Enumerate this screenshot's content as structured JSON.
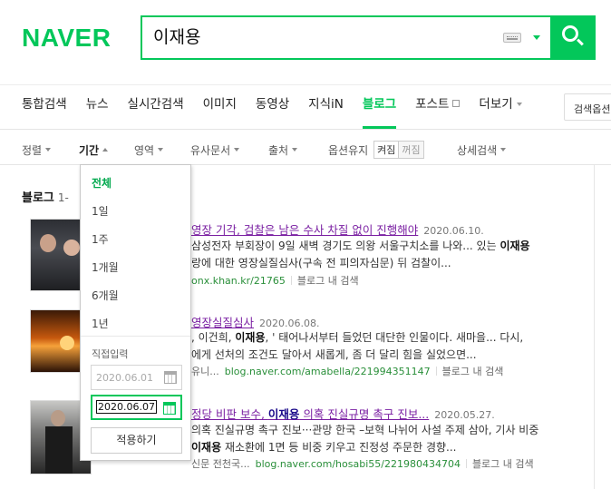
{
  "logo": "NAVER",
  "search": {
    "query": "이재용"
  },
  "tabs": [
    {
      "label": "통합검색"
    },
    {
      "label": "뉴스"
    },
    {
      "label": "실시간검색"
    },
    {
      "label": "이미지"
    },
    {
      "label": "동영상"
    },
    {
      "label": "지식iN"
    },
    {
      "label": "블로그"
    },
    {
      "label": "포스트"
    },
    {
      "label": "더보기"
    }
  ],
  "search_options_label": "검색옵션",
  "filters": {
    "sort": "정렬",
    "period": "기간",
    "area": "영역",
    "similar": "유사문서",
    "source": "출처",
    "option_keep": "옵션유지",
    "toggle_on": "켜짐",
    "toggle_off": "꺼짐",
    "detail": "상세검색"
  },
  "section": {
    "title": "블로그",
    "count": "1-"
  },
  "results": [
    {
      "title": "영장 기각, 검찰은 남은 수사 차질 없이 진행해야",
      "date": "2020.06.10.",
      "desc1_pre": "삼성전자 부회장이 9일 새벽 경기도 의왕 서울구치소를 나와... 있는 ",
      "desc1_bold": "이재용",
      "desc2": "랑에 대한 영장실질심사(구속 전 피의자심문) 뒤 검찰이...",
      "url": "onx.khan.kr/21765",
      "blog_link": "블로그 내 검색"
    },
    {
      "title": "영장실질심사",
      "date": "2020.06.08.",
      "desc1_pre": ", 이건희, ",
      "desc1_bold": "이재용",
      "desc1_post": ", ' 태어나서부터 들었던 대단한 인물이다. 새마을... 다시,",
      "desc2": "에게 선처의 조건도 달아서 새롭게, 좀 더 달리 힘을 실었으면...",
      "url_prefix": "유니...",
      "url": "blog.naver.com/amabella/221994351147",
      "blog_link": "블로그 내 검색"
    },
    {
      "title_pre": "정당 비판 보수, ",
      "title_bold": "이재용",
      "title_post": " 의혹 진실규명 촉구 진보...",
      "date": "2020.05.27.",
      "desc1": "의혹 진실규명 촉구 진보···관망 한국 –보혁 나뉘어 사설 주제 삼아, 기사 비중",
      "desc2_bold": "이재용",
      "desc2_post": " 재소환에 1면 등 비중 키우고 진정성 주문한 경향...",
      "url_prefix": "신문 전천국...",
      "url": "blog.naver.com/hosabi55/221980434704",
      "blog_link": "블로그 내 검색"
    }
  ],
  "period_dropdown": {
    "options": [
      "전체",
      "1일",
      "1주",
      "1개월",
      "6개월",
      "1년"
    ],
    "selected": "전체",
    "direct_label": "직접입력",
    "start_date": "2020.06.01",
    "end_date": "2020.06.07",
    "apply": "적용하기"
  },
  "colors": {
    "brand": "#03c75a",
    "visited_link": "#7a1fa2"
  }
}
